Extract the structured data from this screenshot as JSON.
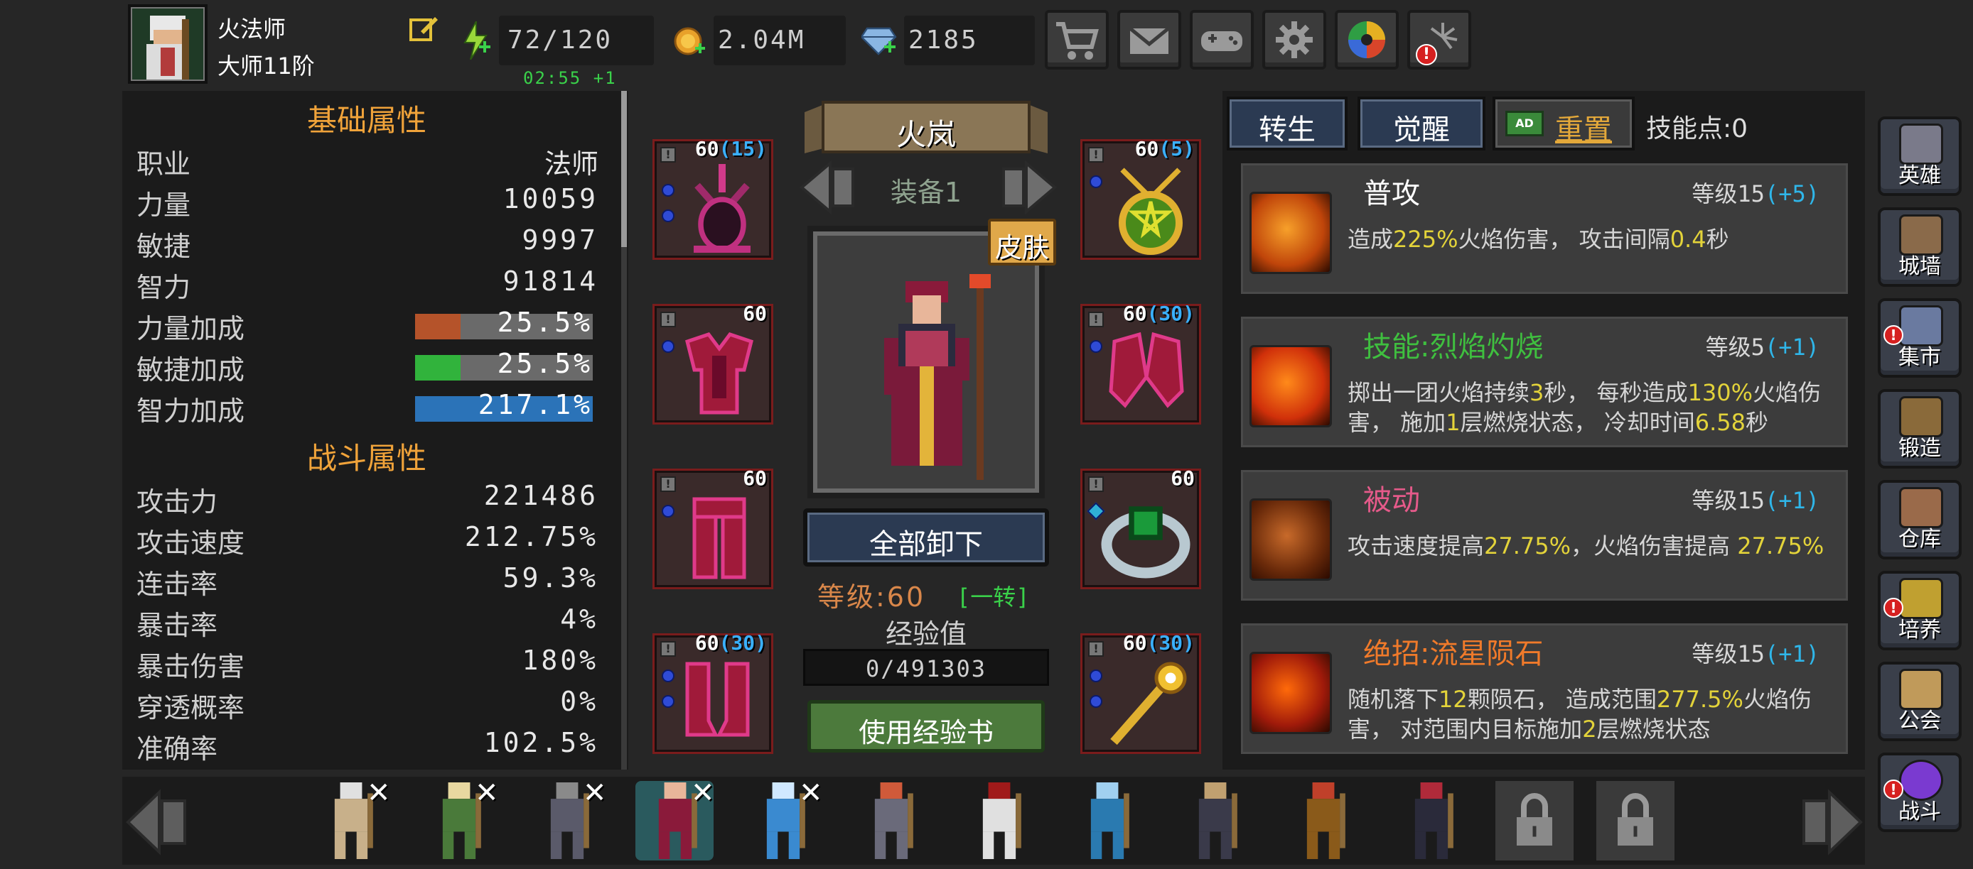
{
  "player": {
    "name": "火法师",
    "rank": "大师11阶",
    "timer": "02:55 +1"
  },
  "resources": {
    "energy": "72/120",
    "gold": "2.04M",
    "diamond": "2185"
  },
  "top_icons": [
    "shop-cart-icon",
    "mail-icon",
    "gamepad-icon",
    "gear-icon",
    "color-wheel-icon",
    "firework-icon"
  ],
  "stats": {
    "basic_title": "基础属性",
    "combat_title": "战斗属性",
    "basic": [
      {
        "label": "职业",
        "value": "法师"
      },
      {
        "label": "力量",
        "value": "10059"
      },
      {
        "label": "敏捷",
        "value": "9997"
      },
      {
        "label": "智力",
        "value": "91814"
      }
    ],
    "bonus": [
      {
        "label": "力量加成",
        "value": "25.5%",
        "fill": 0.255,
        "color": "#b5532a"
      },
      {
        "label": "敏捷加成",
        "value": "25.5%",
        "fill": 0.255,
        "color": "#31b33c"
      },
      {
        "label": "智力加成",
        "value": "217.1%",
        "fill": 1.0,
        "color": "#2b73b8"
      }
    ],
    "combat": [
      {
        "label": "攻击力",
        "value": "221486"
      },
      {
        "label": "攻击速度",
        "value": "212.75%"
      },
      {
        "label": "连击率",
        "value": "59.3%"
      },
      {
        "label": "暴击率",
        "value": "4%"
      },
      {
        "label": "暴击伤害",
        "value": "180%"
      },
      {
        "label": "穿透概率",
        "value": "0%"
      },
      {
        "label": "准确率",
        "value": "102.5%"
      }
    ]
  },
  "hero": {
    "name": "火岚",
    "equip_set": "装备1",
    "skin_label": "皮肤",
    "unequip_all": "全部卸下",
    "level_label": "等级:60",
    "rebirth_tag": "[一转]",
    "exp_label": "经验值",
    "exp_value": "0/491303",
    "exp_fill": 0,
    "use_exp_book": "使用经验书"
  },
  "equipment": {
    "left": [
      {
        "level": "60",
        "bonus": "(15)"
      },
      {
        "level": "60",
        "bonus": ""
      },
      {
        "level": "60",
        "bonus": ""
      },
      {
        "level": "60",
        "bonus": "(30)"
      }
    ],
    "right": [
      {
        "level": "60",
        "bonus": "(5)"
      },
      {
        "level": "60",
        "bonus": "(30)"
      },
      {
        "level": "60",
        "bonus": ""
      },
      {
        "level": "60",
        "bonus": "(30)"
      }
    ]
  },
  "tabs": {
    "rebirth": "转生",
    "awaken": "觉醒",
    "reset": "重置",
    "ad_badge": "AD",
    "skill_points": "技能点:0"
  },
  "skills": [
    {
      "name": "普攻",
      "name_color": "#ffffff",
      "level": "等级15",
      "bonus": "(+5)",
      "desc_parts": [
        "造成",
        "225%",
        "火焰伤害， 攻击间隔",
        "0.4",
        "秒"
      ]
    },
    {
      "name": "技能:烈焰灼烧",
      "name_color": "#3fbf3f",
      "level": "等级5",
      "bonus": "(+1)",
      "desc_parts": [
        "掷出一团火焰持续",
        "3",
        "秒， 每秒造成",
        "130%",
        "火焰伤害， 施加",
        "1",
        "层燃烧状态， 冷却时间",
        "6.58",
        "秒"
      ]
    },
    {
      "name": "被动",
      "name_color": "#e55a8a",
      "level": "等级15",
      "bonus": "(+1)",
      "desc_parts": [
        "攻击速度提高",
        "27.75%",
        "，火焰伤害提高 ",
        "27.75%"
      ]
    },
    {
      "name": "绝招:流星陨石",
      "name_color": "#f07a2a",
      "level": "等级15",
      "bonus": "(+1)",
      "desc_parts": [
        "随机落下",
        "12",
        "颗陨石， 造成范围",
        "277.5%",
        "火焰伤害， 对范围内目标施加",
        "2",
        "层燃烧状态"
      ]
    }
  ],
  "side_menu": [
    {
      "label": "英雄",
      "icon": "helmet-icon",
      "alert": false
    },
    {
      "label": "城墙",
      "icon": "castle-wall-icon",
      "alert": false
    },
    {
      "label": "集市",
      "icon": "market-icon",
      "alert": true
    },
    {
      "label": "锻造",
      "icon": "anvil-icon",
      "alert": false
    },
    {
      "label": "仓库",
      "icon": "storage-icon",
      "alert": false
    },
    {
      "label": "培养",
      "icon": "trophy-icon",
      "alert": true
    },
    {
      "label": "公会",
      "icon": "guild-icon",
      "alert": false
    },
    {
      "label": "战斗",
      "icon": "portal-icon",
      "alert": true
    }
  ],
  "roster_count": 12
}
